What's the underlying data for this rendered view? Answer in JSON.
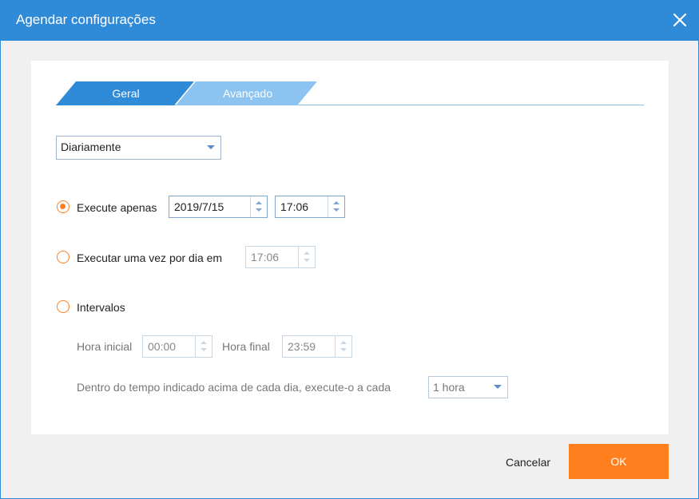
{
  "window": {
    "title": "Agendar configurações"
  },
  "tabs": [
    {
      "label": "Geral",
      "active": true
    },
    {
      "label": "Avançado",
      "active": false
    }
  ],
  "frequency": {
    "selected": "Diariamente"
  },
  "options": {
    "run_once": {
      "label": "Execute apenas",
      "date": "2019/7/15",
      "time": "17:06",
      "checked": true
    },
    "daily": {
      "label": "Executar uma vez por dia em",
      "time": "17:06",
      "checked": false
    },
    "intervals": {
      "label": "Intervalos",
      "checked": false,
      "start_label": "Hora inicial",
      "start_time": "00:00",
      "end_label": "Hora final",
      "end_time": "23:59",
      "repeat_label": "Dentro do tempo indicado acima de cada dia, execute-o a cada",
      "repeat_value": "1 hora"
    }
  },
  "buttons": {
    "cancel": "Cancelar",
    "ok": "OK"
  },
  "colors": {
    "accent": "#2f8ad8",
    "tab_active": "#2f8ad8",
    "tab_inactive": "#8cc3f0",
    "primary_button": "#ff7f1e",
    "radio": "#ff7f1e"
  },
  "icons": {
    "close": "close-icon",
    "dropdown": "chevron-down-icon",
    "spinner": "up-down-arrows-icon"
  }
}
